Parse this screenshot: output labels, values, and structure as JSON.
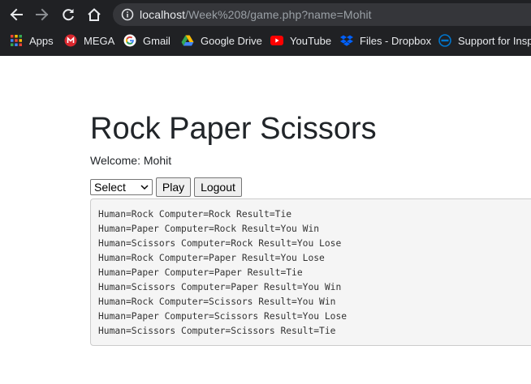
{
  "browser": {
    "url_host": "localhost",
    "url_path": "/Week%208/game.php?name=Mohit",
    "bookmarks": [
      {
        "label": "Apps",
        "icon": "apps-grid-icon"
      },
      {
        "label": "MEGA",
        "icon": "mega-icon"
      },
      {
        "label": "Gmail",
        "icon": "google-icon"
      },
      {
        "label": "Google Drive",
        "icon": "google-drive-icon"
      },
      {
        "label": "YouTube",
        "icon": "youtube-icon"
      },
      {
        "label": "Files - Dropbox",
        "icon": "dropbox-icon"
      },
      {
        "label": "Support for Inspi",
        "icon": "dell-icon"
      }
    ]
  },
  "page": {
    "title": "Rock Paper Scissors",
    "welcome": "Welcome: Mohit",
    "select_value": "Select",
    "play_label": "Play",
    "logout_label": "Logout",
    "results": [
      "Human=Rock Computer=Rock Result=Tie",
      "Human=Paper Computer=Rock Result=You Win",
      "Human=Scissors Computer=Rock Result=You Lose",
      "Human=Rock Computer=Paper Result=You Lose",
      "Human=Paper Computer=Paper Result=Tie",
      "Human=Scissors Computer=Paper Result=You Win",
      "Human=Rock Computer=Scissors Result=You Win",
      "Human=Paper Computer=Scissors Result=You Lose",
      "Human=Scissors Computer=Scissors Result=Tie"
    ]
  }
}
